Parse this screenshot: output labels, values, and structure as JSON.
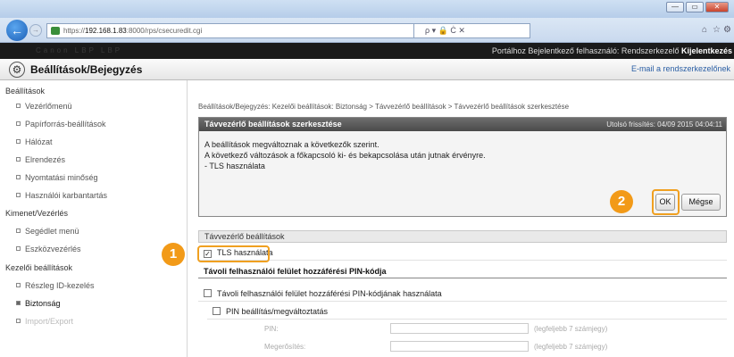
{
  "browser": {
    "url_prefix": "https://",
    "url_host": "192.168.1.83",
    "url_rest": ":8000/rps/csecuredit.cgi",
    "addr_tools": "ρ ▾ 🔒 Ċ ✕",
    "window_controls": [
      "—",
      "▭",
      "✕"
    ]
  },
  "portal": {
    "ghost_text": "Canon  LBP   LBP   ",
    "links": "Portálhoz   Bejelentkező felhasználó: Rendszerkezelő",
    "logout": "Kijelentkezés"
  },
  "header": {
    "title": "Beállítások/Bejegyzés",
    "mail_link": "E-mail a rendszerkezelőnek"
  },
  "sidebar": {
    "sections": [
      {
        "label": "Beállítások",
        "items": [
          "Vezérlőmenü",
          "Papírforrás-beállítások",
          "Hálózat",
          "Elrendezés",
          "Nyomtatási minőség",
          "Használói karbantartás"
        ]
      },
      {
        "label": "Kimenet/Vezérlés",
        "items": [
          "Segédlet menü",
          "Eszközvezérlés"
        ]
      },
      {
        "label": "Kezelői beállítások",
        "items": [
          "Részleg ID-kezelés",
          "Biztonság",
          "Import/Export"
        ]
      }
    ]
  },
  "main": {
    "breadcrumb": "Beállítások/Bejegyzés: Kezelői beállítások: Biztonság > Távvezérlő beállítások > Távvezérlő beállítások szerkesztése",
    "panel_title": "Távvezérlő beállítások szerkesztése",
    "last_update": "Utolsó frissítés: 04/09 2015 04:04:11",
    "message": [
      "A beállítások megváltoznak a következők szerint.",
      "A következő változások a főkapcsoló ki- és bekapcsolása után jutnak érvényre.",
      "- TLS használata"
    ],
    "ok_label": "OK",
    "cancel_label": "Mégse",
    "section_remote": "Távvezérlő beállítások",
    "tls_label": "TLS használata",
    "section_pin": "Távoli felhasználói felület hozzáférési PIN-kódja",
    "use_pin_label": "Távoli felhasználói felület hozzáférési PIN-kódjának használata",
    "pin_set_label": "PIN beállítás/megváltoztatás",
    "pin_label": "PIN:",
    "confirm_label": "Megerősítés:",
    "pin_note": "(legfeljebb 7 számjegy)",
    "confirm_note": "(legfeljebb 7 számjegy)"
  },
  "callouts": [
    "1",
    "2"
  ],
  "accent_color": "#f29a18"
}
